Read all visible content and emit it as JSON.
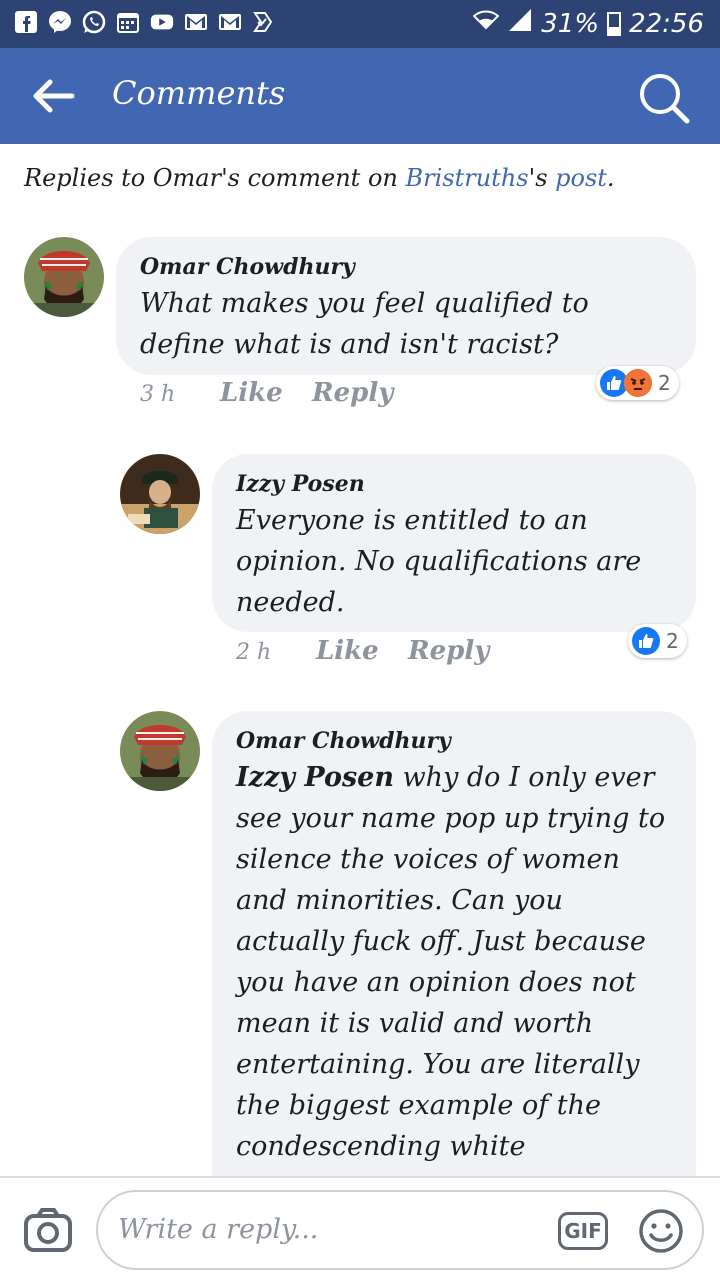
{
  "status_bar": {
    "app_icons": [
      "facebook-icon",
      "messenger-icon",
      "whatsapp-icon",
      "calendar-icon",
      "youtube-icon",
      "gmail-icon",
      "gmail-icon",
      "check-icon"
    ],
    "battery": "31%",
    "battery_level": 0.31,
    "time": "22:56"
  },
  "app_bar": {
    "title": "Comments"
  },
  "replies_header": {
    "prefix": "Replies to Omar's comment on ",
    "page_name": "Bristruths",
    "possessive": "'s ",
    "post_link": "post",
    "suffix": "."
  },
  "comments": [
    {
      "author": "Omar Chowdhury",
      "text": "What makes you feel qualified to define what is and isn't racist?",
      "time": "3 h",
      "like_label": "Like",
      "reply_label": "Reply",
      "reaction_count": "2",
      "reactions": [
        "like-icon",
        "angry-icon"
      ]
    },
    {
      "author": "Izzy Posen",
      "text": "Everyone is entitled to an opinion. No qualifications are needed.",
      "time": "2 h",
      "like_label": "Like",
      "reply_label": "Reply",
      "reaction_count": "2",
      "reactions": [
        "like-icon"
      ]
    },
    {
      "author": "Omar Chowdhury",
      "mention": "Izzy Posen",
      "text": " why do I only ever see your name pop up trying to silence the voices of women and minorities. Can you actually fuck off. Just because you have an opinion does not mean it is valid and worth entertaining. You are literally the biggest example of the condescending white"
    }
  ],
  "composer": {
    "placeholder": "Write a reply...",
    "gif_label": "GIF"
  },
  "colors": {
    "status_bar": "#2d4373",
    "app_bar": "#4267b2",
    "link": "#4267b2",
    "bubble": "#f0f2f5",
    "meta": "#8d949e"
  }
}
